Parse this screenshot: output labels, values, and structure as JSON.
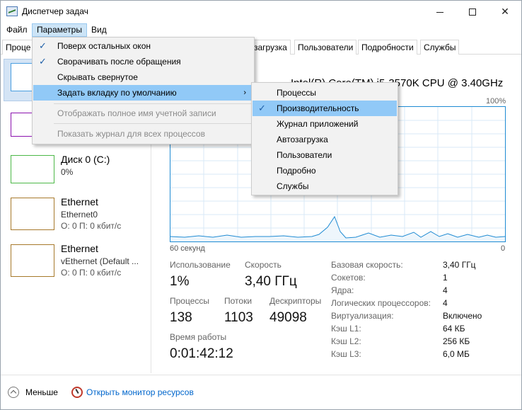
{
  "window": {
    "title": "Диспетчер задач",
    "min": "",
    "max": "",
    "close": "✕"
  },
  "menubar": {
    "file": "Файл",
    "params": "Параметры",
    "view": "Вид"
  },
  "tabs": [
    "Проце",
    "загрузка",
    "Пользователи",
    "Подробности",
    "Службы"
  ],
  "left_panel": {
    "disk_title": "Диск 0 (C:)",
    "disk_value": "0%",
    "eth1_title": "Ethernet",
    "eth1_name": "Ethernet0",
    "eth1_rate": "О: 0 П: 0 кбит/с",
    "eth2_title": "Ethernet",
    "eth2_name": "vEthernet (Default ...",
    "eth2_rate": "О: 0 П: 0 кбит/с"
  },
  "cpu": {
    "model": "Intel(R) Core(TM) i5-3570K CPU @ 3.40GHz",
    "pct_max": "100%",
    "time_label": "60 секунд",
    "zero_label": "0",
    "usage_label": "Использование",
    "usage_value": "1%",
    "speed_label": "Скорость",
    "speed_value": "3,40 ГГц",
    "processes_label": "Процессы",
    "processes_value": "138",
    "threads_label": "Потоки",
    "threads_value": "1103",
    "handles_label": "Дескрипторы",
    "handles_value": "49098",
    "uptime_label": "Время работы",
    "uptime_value": "0:01:42:12",
    "info": [
      {
        "label": "Базовая скорость:",
        "value": "3,40 ГГц"
      },
      {
        "label": "Сокетов:",
        "value": "1"
      },
      {
        "label": "Ядра:",
        "value": "4"
      },
      {
        "label": "Логических процессоров:",
        "value": "4"
      },
      {
        "label": "Виртуализация:",
        "value": "Включено"
      },
      {
        "label": "Кэш L1:",
        "value": "64 КБ"
      },
      {
        "label": "Кэш L2:",
        "value": "256 КБ"
      },
      {
        "label": "Кэш L3:",
        "value": "6,0 МБ"
      }
    ]
  },
  "footer": {
    "less": "Меньше",
    "monitor": "Открыть монитор ресурсов"
  },
  "params_menu": {
    "items": [
      {
        "label": "Поверх остальных окон",
        "checked": true
      },
      {
        "label": "Сворачивать после обращения",
        "checked": true
      },
      {
        "label": "Скрывать свернутое",
        "checked": false
      },
      {
        "label": "Задать вкладку по умолчанию",
        "checked": false
      },
      {
        "label": "Отображать полное имя учетной записи",
        "checked": false
      },
      {
        "label": "Показать журнал для всех процессов",
        "checked": false
      }
    ],
    "arrow": "›"
  },
  "default_tab_menu": {
    "items": [
      {
        "label": "Процессы",
        "checked": false
      },
      {
        "label": "Производительность",
        "checked": true
      },
      {
        "label": "Журнал приложений",
        "checked": false
      },
      {
        "label": "Автозагрузка",
        "checked": false
      },
      {
        "label": "Пользователи",
        "checked": false
      },
      {
        "label": "Подробно",
        "checked": false
      },
      {
        "label": "Службы",
        "checked": false
      }
    ]
  },
  "check_glyph": "✓",
  "colors": {
    "cpu_line": "#1f8bd3",
    "menu_highlight": "#91c9f7",
    "selected_item": "#d4e4f5",
    "link": "#0066cc"
  }
}
